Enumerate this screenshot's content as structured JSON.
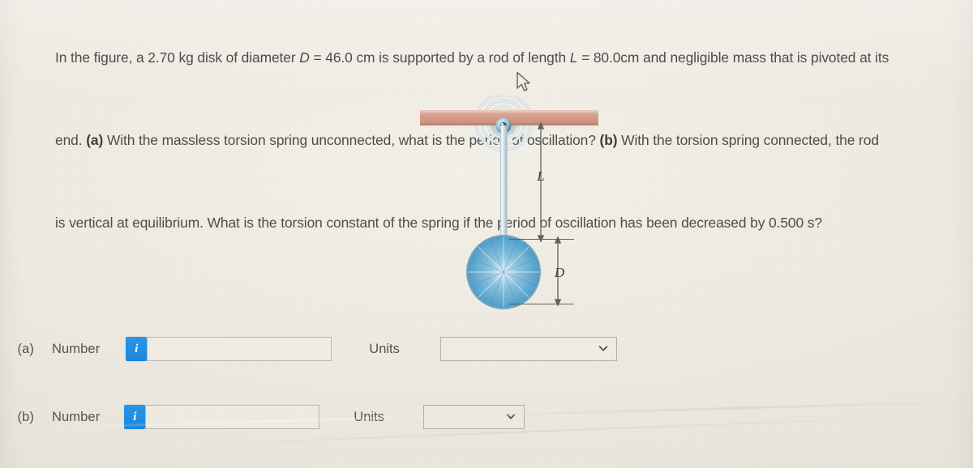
{
  "problem": {
    "line1_a": "In the figure, a 2.70 kg disk of diameter ",
    "line1_var_D": "D",
    "line1_b": " = 46.0 cm is supported by a rod of length ",
    "line1_var_L": "L",
    "line1_c": " = 80.0cm and negligible mass that is pivoted at its",
    "line2_a": "end. ",
    "line2_bold_a": "(a)",
    "line2_b": " With the massless torsion spring unconnected, what is the period of oscillation? ",
    "line2_bold_b": "(b)",
    "line2_c": " With the torsion spring connected, the rod",
    "line3": "is vertical at equilibrium. What is the torsion constant of the spring if the period of oscillation has been decreased by 0.500 s?",
    "values": {
      "mass_kg": "2.70",
      "diameter_cm": "46.0",
      "length_cm": "80.0",
      "period_decrease_s": "0.500"
    }
  },
  "figure": {
    "label_L": "L",
    "label_D": "D",
    "colors": {
      "beam": "#d8a495",
      "rod": "#cfe0e8",
      "disk": "#72b4d6",
      "dimension_line": "#5d5d5d",
      "spring": "#c9d8e2"
    },
    "parts": {
      "beam": "support-beam",
      "pivot": "pivot-point",
      "spring": "torsion-spring",
      "rod": "rod",
      "disk": "disk"
    }
  },
  "answers": {
    "row_a": {
      "paren": "(a)",
      "number_label": "Number",
      "info_icon_glyph": "i",
      "number_value": "",
      "number_placeholder": "",
      "units_label": "Units",
      "units_selected": "",
      "chevron": "chevron-down"
    },
    "row_b": {
      "paren": "(b)",
      "number_label": "Number",
      "info_icon_glyph": "i",
      "number_value": "",
      "number_placeholder": "",
      "units_label": "Units",
      "units_selected": "",
      "chevron": "chevron-down"
    }
  },
  "cursor": {
    "type": "arrow-pointer"
  }
}
